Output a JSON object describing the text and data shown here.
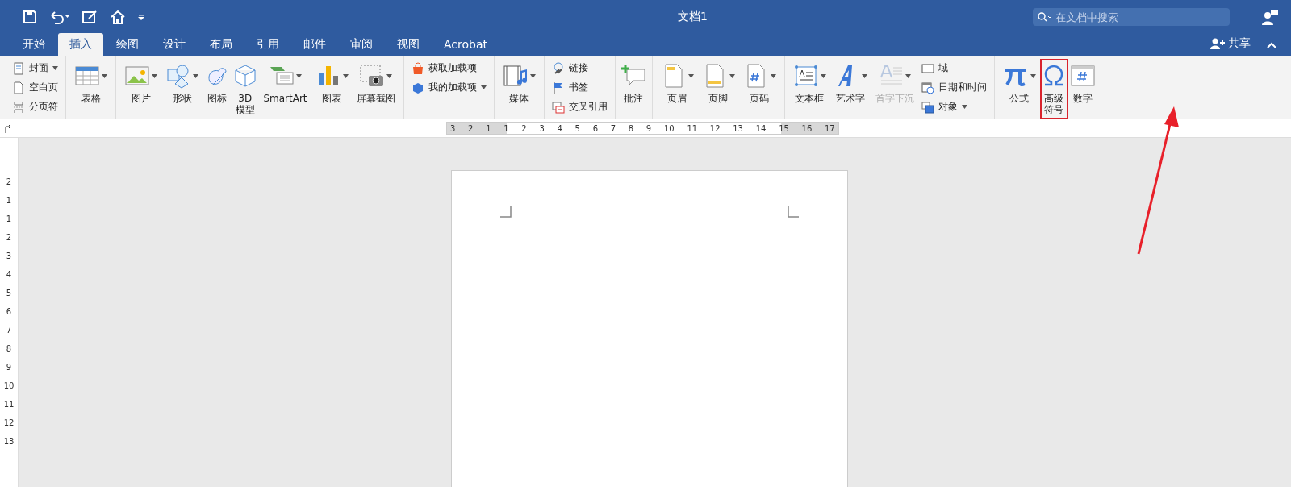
{
  "window": {
    "title": "文档1"
  },
  "search": {
    "placeholder": "在文档中搜索"
  },
  "tabs": [
    {
      "label": "开始",
      "selected": false
    },
    {
      "label": "插入",
      "selected": true
    },
    {
      "label": "绘图",
      "selected": false
    },
    {
      "label": "设计",
      "selected": false
    },
    {
      "label": "布局",
      "selected": false
    },
    {
      "label": "引用",
      "selected": false
    },
    {
      "label": "邮件",
      "selected": false
    },
    {
      "label": "审阅",
      "selected": false
    },
    {
      "label": "视图",
      "selected": false
    },
    {
      "label": "Acrobat",
      "selected": false
    }
  ],
  "share": {
    "label": "共享"
  },
  "ribbon_groups": [
    {
      "items": [
        {
          "kind": "stack",
          "items": [
            {
              "label": "封面",
              "dropdown": true
            },
            {
              "label": "空白页",
              "dropdown": false
            },
            {
              "label": "分页符",
              "dropdown": false
            }
          ]
        }
      ]
    },
    {
      "items": [
        {
          "kind": "large",
          "label": "表格",
          "dropdown": true,
          "disabled": false,
          "highlighted": false
        }
      ]
    },
    {
      "items": [
        {
          "kind": "large",
          "label": "图片",
          "dropdown": true,
          "disabled": false,
          "highlighted": false
        },
        {
          "kind": "large",
          "label": "形状",
          "dropdown": true,
          "disabled": false,
          "highlighted": false
        },
        {
          "kind": "large",
          "label": "图标",
          "dropdown": false,
          "disabled": false,
          "highlighted": false
        },
        {
          "kind": "large",
          "label": "3D模型",
          "dropdown": false,
          "disabled": false,
          "highlighted": false
        },
        {
          "kind": "large",
          "label": "SmartArt",
          "dropdown": true,
          "disabled": false,
          "highlighted": false
        },
        {
          "kind": "large",
          "label": "图表",
          "dropdown": true,
          "disabled": false,
          "highlighted": false
        },
        {
          "kind": "large",
          "label": "屏幕截图",
          "dropdown": true,
          "disabled": false,
          "highlighted": false
        }
      ]
    },
    {
      "items": [
        {
          "kind": "stack",
          "items": [
            {
              "label": "获取加载项",
              "dropdown": false
            },
            {
              "label": "我的加载项",
              "dropdown": true
            }
          ]
        }
      ]
    },
    {
      "items": [
        {
          "kind": "large",
          "label": "媒体",
          "dropdown": true,
          "disabled": false,
          "highlighted": false
        }
      ]
    },
    {
      "items": [
        {
          "kind": "stack",
          "items": [
            {
              "label": "链接",
              "dropdown": false
            },
            {
              "label": "书签",
              "dropdown": false
            },
            {
              "label": "交叉引用",
              "dropdown": false
            }
          ]
        }
      ]
    },
    {
      "items": [
        {
          "kind": "large",
          "label": "批注",
          "dropdown": false,
          "disabled": false,
          "highlighted": false
        }
      ]
    },
    {
      "items": [
        {
          "kind": "large",
          "label": "页眉",
          "dropdown": true,
          "disabled": false,
          "highlighted": false
        },
        {
          "kind": "large",
          "label": "页脚",
          "dropdown": true,
          "disabled": false,
          "highlighted": false
        },
        {
          "kind": "large",
          "label": "页码",
          "dropdown": true,
          "disabled": false,
          "highlighted": false
        }
      ]
    },
    {
      "items": [
        {
          "kind": "large",
          "label": "文本框",
          "dropdown": true,
          "disabled": false,
          "highlighted": false
        },
        {
          "kind": "large",
          "label": "艺术字",
          "dropdown": true,
          "disabled": false,
          "highlighted": false
        },
        {
          "kind": "large",
          "label": "首字下沉",
          "dropdown": true,
          "disabled": true,
          "highlighted": false
        },
        {
          "kind": "stack",
          "items": [
            {
              "label": "域",
              "dropdown": false
            },
            {
              "label": "日期和时间",
              "dropdown": false
            },
            {
              "label": "对象",
              "dropdown": true
            }
          ]
        }
      ]
    },
    {
      "items": [
        {
          "kind": "large",
          "label": "公式",
          "dropdown": true,
          "disabled": false,
          "highlighted": false
        },
        {
          "kind": "large",
          "label": "高级符号",
          "dropdown": false,
          "disabled": false,
          "highlighted": true
        },
        {
          "kind": "large",
          "label": "数字",
          "dropdown": false,
          "disabled": false,
          "highlighted": false
        }
      ]
    }
  ],
  "horizontal_ruler": [
    "3",
    "2",
    "1",
    "1",
    "2",
    "3",
    "4",
    "5",
    "6",
    "7",
    "8",
    "9",
    "10",
    "11",
    "12",
    "13",
    "14",
    "15",
    "16",
    "17"
  ],
  "vertical_ruler": [
    "2",
    "1",
    "1",
    "2",
    "3",
    "4",
    "5",
    "6",
    "7",
    "8",
    "9",
    "10",
    "11",
    "12",
    "13"
  ]
}
